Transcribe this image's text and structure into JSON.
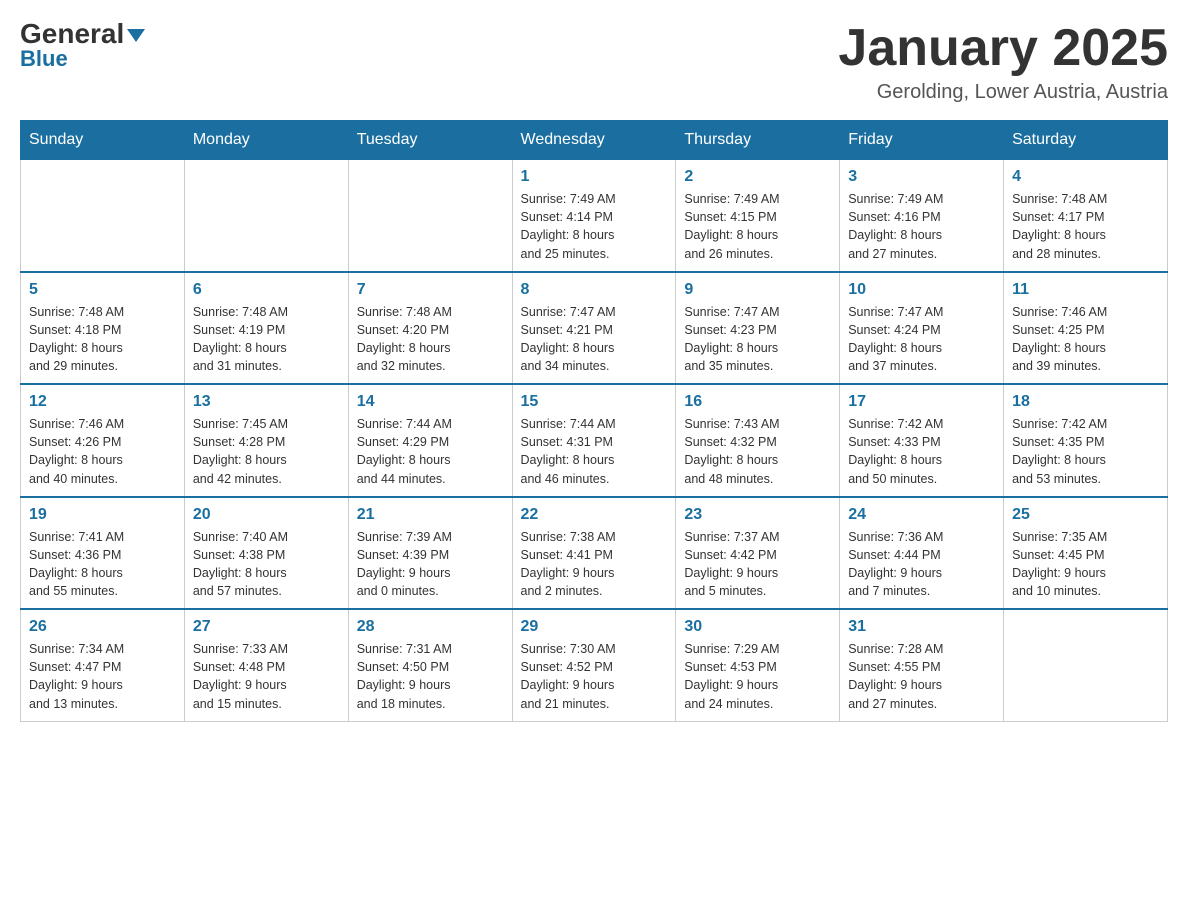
{
  "header": {
    "logo_general": "General",
    "logo_blue": "Blue",
    "title": "January 2025",
    "subtitle": "Gerolding, Lower Austria, Austria"
  },
  "weekdays": [
    "Sunday",
    "Monday",
    "Tuesday",
    "Wednesday",
    "Thursday",
    "Friday",
    "Saturday"
  ],
  "weeks": [
    [
      {
        "day": "",
        "info": ""
      },
      {
        "day": "",
        "info": ""
      },
      {
        "day": "",
        "info": ""
      },
      {
        "day": "1",
        "info": "Sunrise: 7:49 AM\nSunset: 4:14 PM\nDaylight: 8 hours\nand 25 minutes."
      },
      {
        "day": "2",
        "info": "Sunrise: 7:49 AM\nSunset: 4:15 PM\nDaylight: 8 hours\nand 26 minutes."
      },
      {
        "day": "3",
        "info": "Sunrise: 7:49 AM\nSunset: 4:16 PM\nDaylight: 8 hours\nand 27 minutes."
      },
      {
        "day": "4",
        "info": "Sunrise: 7:48 AM\nSunset: 4:17 PM\nDaylight: 8 hours\nand 28 minutes."
      }
    ],
    [
      {
        "day": "5",
        "info": "Sunrise: 7:48 AM\nSunset: 4:18 PM\nDaylight: 8 hours\nand 29 minutes."
      },
      {
        "day": "6",
        "info": "Sunrise: 7:48 AM\nSunset: 4:19 PM\nDaylight: 8 hours\nand 31 minutes."
      },
      {
        "day": "7",
        "info": "Sunrise: 7:48 AM\nSunset: 4:20 PM\nDaylight: 8 hours\nand 32 minutes."
      },
      {
        "day": "8",
        "info": "Sunrise: 7:47 AM\nSunset: 4:21 PM\nDaylight: 8 hours\nand 34 minutes."
      },
      {
        "day": "9",
        "info": "Sunrise: 7:47 AM\nSunset: 4:23 PM\nDaylight: 8 hours\nand 35 minutes."
      },
      {
        "day": "10",
        "info": "Sunrise: 7:47 AM\nSunset: 4:24 PM\nDaylight: 8 hours\nand 37 minutes."
      },
      {
        "day": "11",
        "info": "Sunrise: 7:46 AM\nSunset: 4:25 PM\nDaylight: 8 hours\nand 39 minutes."
      }
    ],
    [
      {
        "day": "12",
        "info": "Sunrise: 7:46 AM\nSunset: 4:26 PM\nDaylight: 8 hours\nand 40 minutes."
      },
      {
        "day": "13",
        "info": "Sunrise: 7:45 AM\nSunset: 4:28 PM\nDaylight: 8 hours\nand 42 minutes."
      },
      {
        "day": "14",
        "info": "Sunrise: 7:44 AM\nSunset: 4:29 PM\nDaylight: 8 hours\nand 44 minutes."
      },
      {
        "day": "15",
        "info": "Sunrise: 7:44 AM\nSunset: 4:31 PM\nDaylight: 8 hours\nand 46 minutes."
      },
      {
        "day": "16",
        "info": "Sunrise: 7:43 AM\nSunset: 4:32 PM\nDaylight: 8 hours\nand 48 minutes."
      },
      {
        "day": "17",
        "info": "Sunrise: 7:42 AM\nSunset: 4:33 PM\nDaylight: 8 hours\nand 50 minutes."
      },
      {
        "day": "18",
        "info": "Sunrise: 7:42 AM\nSunset: 4:35 PM\nDaylight: 8 hours\nand 53 minutes."
      }
    ],
    [
      {
        "day": "19",
        "info": "Sunrise: 7:41 AM\nSunset: 4:36 PM\nDaylight: 8 hours\nand 55 minutes."
      },
      {
        "day": "20",
        "info": "Sunrise: 7:40 AM\nSunset: 4:38 PM\nDaylight: 8 hours\nand 57 minutes."
      },
      {
        "day": "21",
        "info": "Sunrise: 7:39 AM\nSunset: 4:39 PM\nDaylight: 9 hours\nand 0 minutes."
      },
      {
        "day": "22",
        "info": "Sunrise: 7:38 AM\nSunset: 4:41 PM\nDaylight: 9 hours\nand 2 minutes."
      },
      {
        "day": "23",
        "info": "Sunrise: 7:37 AM\nSunset: 4:42 PM\nDaylight: 9 hours\nand 5 minutes."
      },
      {
        "day": "24",
        "info": "Sunrise: 7:36 AM\nSunset: 4:44 PM\nDaylight: 9 hours\nand 7 minutes."
      },
      {
        "day": "25",
        "info": "Sunrise: 7:35 AM\nSunset: 4:45 PM\nDaylight: 9 hours\nand 10 minutes."
      }
    ],
    [
      {
        "day": "26",
        "info": "Sunrise: 7:34 AM\nSunset: 4:47 PM\nDaylight: 9 hours\nand 13 minutes."
      },
      {
        "day": "27",
        "info": "Sunrise: 7:33 AM\nSunset: 4:48 PM\nDaylight: 9 hours\nand 15 minutes."
      },
      {
        "day": "28",
        "info": "Sunrise: 7:31 AM\nSunset: 4:50 PM\nDaylight: 9 hours\nand 18 minutes."
      },
      {
        "day": "29",
        "info": "Sunrise: 7:30 AM\nSunset: 4:52 PM\nDaylight: 9 hours\nand 21 minutes."
      },
      {
        "day": "30",
        "info": "Sunrise: 7:29 AM\nSunset: 4:53 PM\nDaylight: 9 hours\nand 24 minutes."
      },
      {
        "day": "31",
        "info": "Sunrise: 7:28 AM\nSunset: 4:55 PM\nDaylight: 9 hours\nand 27 minutes."
      },
      {
        "day": "",
        "info": ""
      }
    ]
  ]
}
